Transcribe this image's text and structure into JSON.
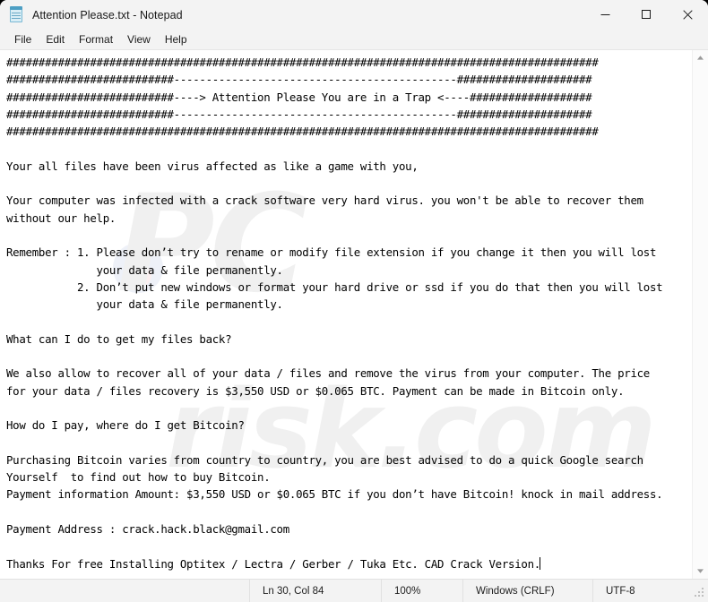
{
  "window": {
    "title": "Attention Please.txt - Notepad",
    "icon": "notepad-icon",
    "controls": {
      "minimize_label": "Minimize",
      "maximize_label": "Maximize",
      "close_label": "Close"
    }
  },
  "menu": {
    "items": [
      {
        "label": "File"
      },
      {
        "label": "Edit"
      },
      {
        "label": "Format"
      },
      {
        "label": "View"
      },
      {
        "label": "Help"
      }
    ]
  },
  "editor": {
    "content": "############################################################################################\n##########################--------------------------------------------#####################\n##########################----> Attention Please You are in a Trap <----###################\n##########################--------------------------------------------#####################\n############################################################################################\n\nYour all files have been virus affected as like a game with you,\n\nYour computer was infected with a crack software very hard virus. you won't be able to recover them\nwithout our help.\n\nRemember : 1. Please don’t try to rename or modify file extension if you change it then you will lost\n              your data & file permanently.\n           2. Don’t put new windows or format your hard drive or ssd if you do that then you will lost\n              your data & file permanently.\n\nWhat can I do to get my files back?\n\nWe also allow to recover all of your data / files and remove the virus from your computer. The price\nfor your data / files recovery is $3,550 USD or $0.065 BTC. Payment can be made in Bitcoin only.\n\nHow do I pay, where do I get Bitcoin?\n\nPurchasing Bitcoin varies from country to country, you are best advised to do a quick Google search\nYourself  to find out how to buy Bitcoin.\nPayment information Amount: $3,550 USD or $0.065 BTC if you don’t have Bitcoin! knock in mail address.\n\nPayment Address : crack.hack.black@gmail.com\n\nThanks For free Installing Optitex / Lectra / Gerber / Tuka Etc. CAD Crack Version.",
    "watermark_top": "PC",
    "watermark_bottom": "risk.com",
    "price_usd": "$3,550 USD",
    "price_btc": "$0.065 BTC",
    "contact_email": "crack.hack.black@gmail.com"
  },
  "scrollbar": {
    "up_icon": "chevron-up-icon",
    "down_icon": "chevron-down-icon"
  },
  "statusbar": {
    "cursor_position": "Ln 30, Col 84",
    "zoom": "100%",
    "line_ending": "Windows (CRLF)",
    "encoding": "UTF-8"
  }
}
